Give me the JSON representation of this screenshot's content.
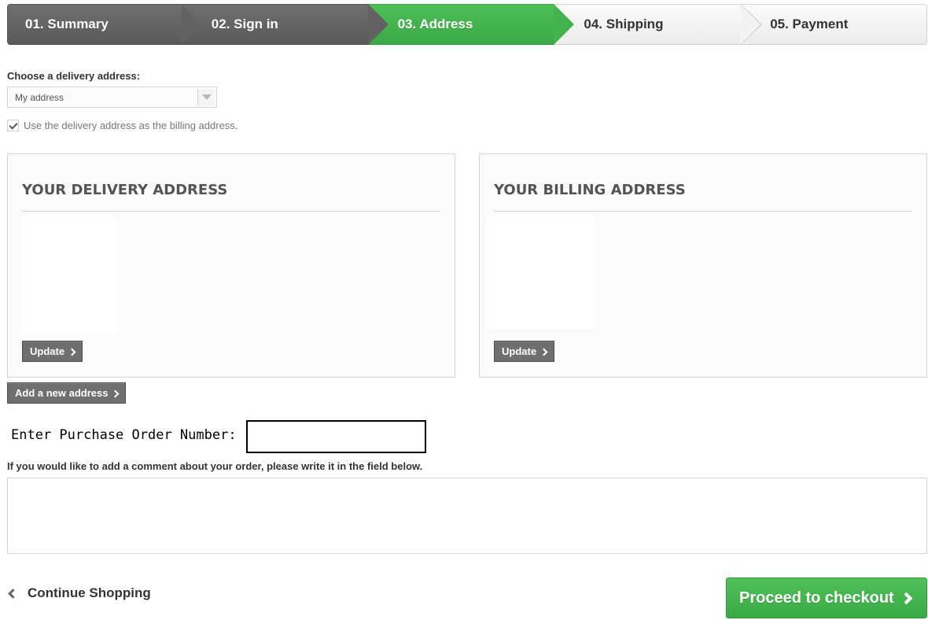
{
  "steps": [
    {
      "label": "01. Summary",
      "state": "done"
    },
    {
      "label": "02. Sign in",
      "state": "done"
    },
    {
      "label": "03. Address",
      "state": "current"
    },
    {
      "label": "04. Shipping",
      "state": "todo"
    },
    {
      "label": "05. Payment",
      "state": "todo"
    }
  ],
  "address_select": {
    "label": "Choose a delivery address:",
    "selected": "My address"
  },
  "same_billing": {
    "label": "Use the delivery address as the billing address.",
    "checked": true
  },
  "delivery": {
    "title": "YOUR DELIVERY ADDRESS",
    "update_label": "Update"
  },
  "billing": {
    "title": "YOUR BILLING ADDRESS",
    "update_label": "Update"
  },
  "add_address_label": "Add a new address",
  "po": {
    "label": "Enter Purchase Order Number:",
    "value": ""
  },
  "comment": {
    "label": "If you would like to add a comment about your order, please write it in the field below.",
    "value": ""
  },
  "nav": {
    "continue_label": "Continue Shopping",
    "checkout_label": "Proceed to checkout"
  },
  "colors": {
    "accent_green": "#43b14e",
    "step_done_grey": "#626262",
    "button_grey": "#6f6f6f"
  },
  "icons": {
    "step_separator": "chevron-right-icon",
    "select_toggle": "caret-down-icon",
    "checkbox": "checkmark-icon",
    "button_arrow": "chevron-right-icon",
    "continue_arrow": "chevron-left-icon"
  }
}
